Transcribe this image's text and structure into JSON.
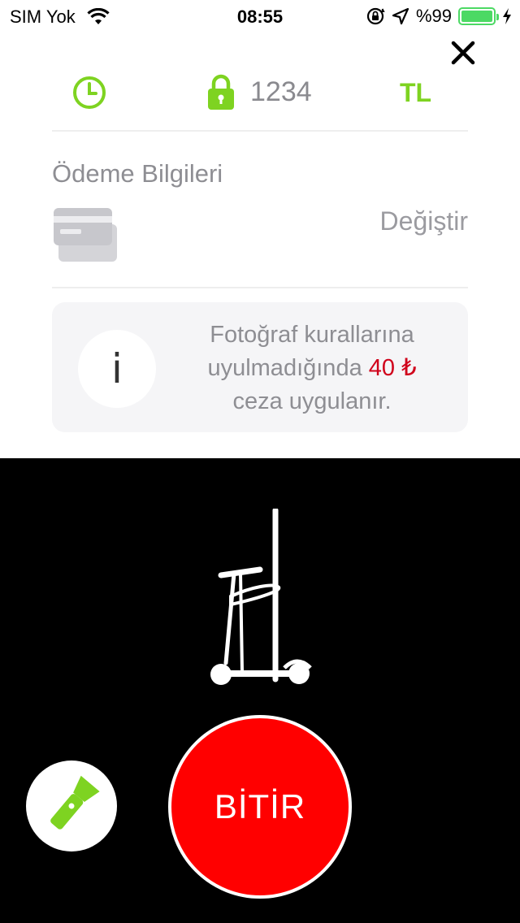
{
  "status_bar": {
    "carrier": "SIM Yok",
    "time": "08:55",
    "battery": "%99",
    "battery_level": 0.99
  },
  "trip_info": {
    "lock_code": "1234",
    "currency": "TL"
  },
  "payment": {
    "title": "Ödeme Bilgileri",
    "change_label": "Değiştir"
  },
  "notice": {
    "icon_glyph": "i",
    "text_line1": "Fotoğraf kurallarına",
    "text_line2": "uyulmadığında",
    "amount": "40 ₺",
    "text_line3": "ceza uygulanır."
  },
  "actions": {
    "finish_label": "BİTİR"
  },
  "colors": {
    "accent_green": "#7ed321",
    "finish_red": "#ff0000",
    "penalty_red": "#d0021b"
  }
}
